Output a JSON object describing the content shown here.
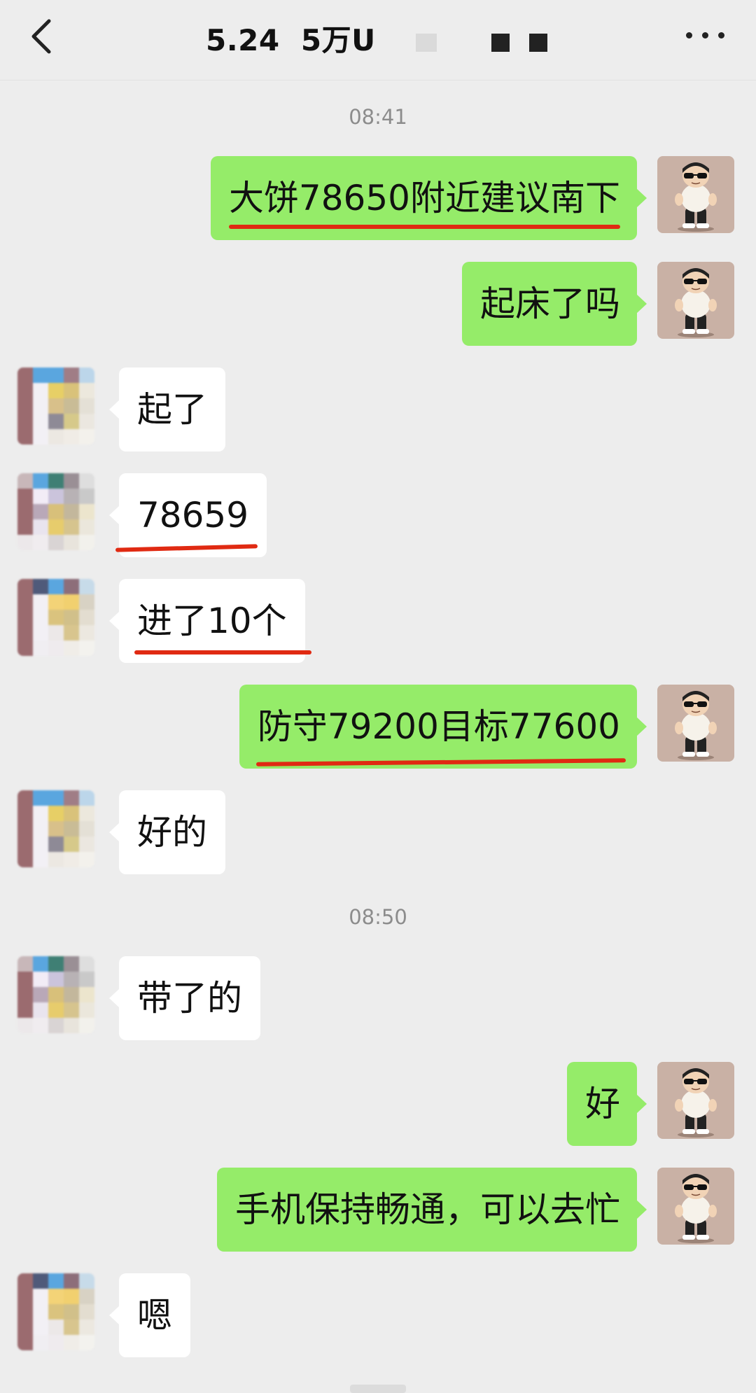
{
  "header": {
    "title": "5.24  5万U"
  },
  "icons": {
    "back": "chevron-left-icon",
    "more": "more-dots-icon"
  },
  "colors": {
    "outgoing_bubble": "#95ec69",
    "incoming_bubble": "#ffffff",
    "background": "#ededed",
    "highlight_underline": "#e02a12"
  },
  "timestamps": [
    "08:41",
    "08:50"
  ],
  "messages": [
    {
      "side": "me",
      "text": "大饼78650附近建议南下",
      "underlined": true
    },
    {
      "side": "me",
      "text": "起床了吗",
      "underlined": false
    },
    {
      "side": "peer",
      "text": "起了",
      "underlined": false
    },
    {
      "side": "peer",
      "text": "78659",
      "underlined": true
    },
    {
      "side": "peer",
      "text": "进了10个",
      "underlined": true
    },
    {
      "side": "me",
      "text": "防守79200目标77600",
      "underlined": true
    },
    {
      "side": "peer",
      "text": "好的",
      "underlined": false
    },
    {
      "side": "peer",
      "text": "带了的",
      "underlined": false
    },
    {
      "side": "me",
      "text": "好",
      "underlined": false
    },
    {
      "side": "me",
      "text": "手机保持畅通，可以去忙",
      "underlined": false
    },
    {
      "side": "peer",
      "text": "嗯",
      "underlined": false
    }
  ]
}
